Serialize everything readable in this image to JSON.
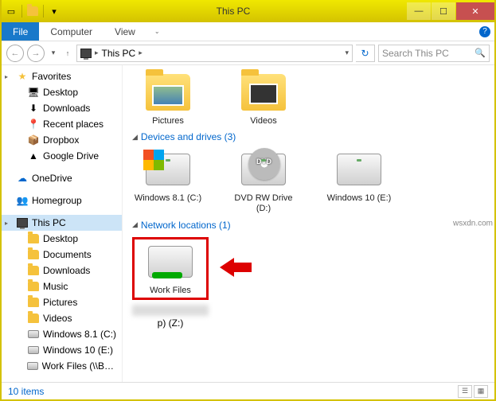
{
  "titlebar": {
    "title": "This PC"
  },
  "window_controls": {
    "min": "—",
    "max": "☐",
    "close": "✕"
  },
  "ribbon": {
    "file": "File",
    "computer": "Computer",
    "view": "View"
  },
  "nav": {
    "back": "←",
    "forward": "→",
    "recent": "▾",
    "up": "↑"
  },
  "address": {
    "path": "This PC",
    "crumb_caret": "▸",
    "dropdown": "▾",
    "refresh": "↻"
  },
  "search": {
    "placeholder": "Search This PC",
    "icon": "🔍"
  },
  "sidebar": {
    "favorites": {
      "label": "Favorites",
      "items": [
        {
          "icon": "🖥",
          "label": "Desktop"
        },
        {
          "icon": "⬇",
          "label": "Downloads"
        },
        {
          "icon": "📍",
          "label": "Recent places"
        },
        {
          "icon": "📦",
          "label": "Dropbox"
        },
        {
          "icon": "☁",
          "label": "Google Drive"
        }
      ]
    },
    "onedrive": {
      "label": "OneDrive"
    },
    "homegroup": {
      "label": "Homegroup"
    },
    "thispc": {
      "label": "This PC",
      "items": [
        {
          "label": "Desktop"
        },
        {
          "label": "Documents"
        },
        {
          "label": "Downloads"
        },
        {
          "label": "Music"
        },
        {
          "label": "Pictures"
        },
        {
          "label": "Videos"
        },
        {
          "label": "Windows 8.1 (C:)"
        },
        {
          "label": "Windows 10 (E:)"
        },
        {
          "label": "Work Files (\\\\BENZ"
        }
      ]
    }
  },
  "content": {
    "folders": [
      {
        "name": "pictures",
        "label": "Pictures"
      },
      {
        "name": "videos",
        "label": "Videos"
      }
    ],
    "group_drives": {
      "label": "Devices and drives (3)"
    },
    "drives": [
      {
        "name": "drive-c",
        "label": "Windows 8.1 (C:)"
      },
      {
        "name": "drive-d",
        "label": "DVD RW Drive (D:)"
      },
      {
        "name": "drive-e",
        "label": "Windows 10 (E:)"
      }
    ],
    "group_network": {
      "label": "Network locations (1)"
    },
    "network": [
      {
        "name": "work-files",
        "label": "Work Files",
        "line2": "p) (Z:)"
      }
    ]
  },
  "statusbar": {
    "count": "10 items"
  },
  "watermark": "wsxdn.com"
}
